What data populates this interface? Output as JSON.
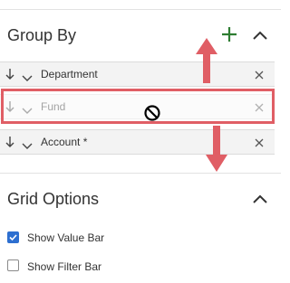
{
  "group_by": {
    "title": "Group By",
    "add_icon": "plus-icon",
    "collapse_icon": "chevron-up-icon",
    "rows": [
      {
        "label": "Department",
        "sort_icon": "arrow-down-icon",
        "expand_icon": "chevron-down-icon",
        "remove_icon": "close-icon"
      },
      {
        "label": "Fund",
        "sort_icon": "arrow-down-icon",
        "expand_icon": "chevron-down-icon",
        "remove_icon": "close-icon",
        "state": "dragging"
      },
      {
        "label": "Account *",
        "sort_icon": "arrow-down-icon",
        "expand_icon": "chevron-down-icon",
        "remove_icon": "close-icon"
      }
    ]
  },
  "grid_options": {
    "title": "Grid Options",
    "collapse_icon": "chevron-up-icon",
    "options": [
      {
        "label": "Show Value Bar",
        "checked": true
      },
      {
        "label": "Show Filter Bar",
        "checked": false
      }
    ]
  },
  "overlay": {
    "cursor_icon": "no-drop-icon",
    "arrow_icons": [
      "arrow-up-icon",
      "arrow-down-icon"
    ]
  },
  "colors": {
    "accent_green": "#2e7d32",
    "highlight_red": "#e05e65",
    "checkbox_blue": "#2d6fd0",
    "row_background": "#f3f3f3"
  }
}
